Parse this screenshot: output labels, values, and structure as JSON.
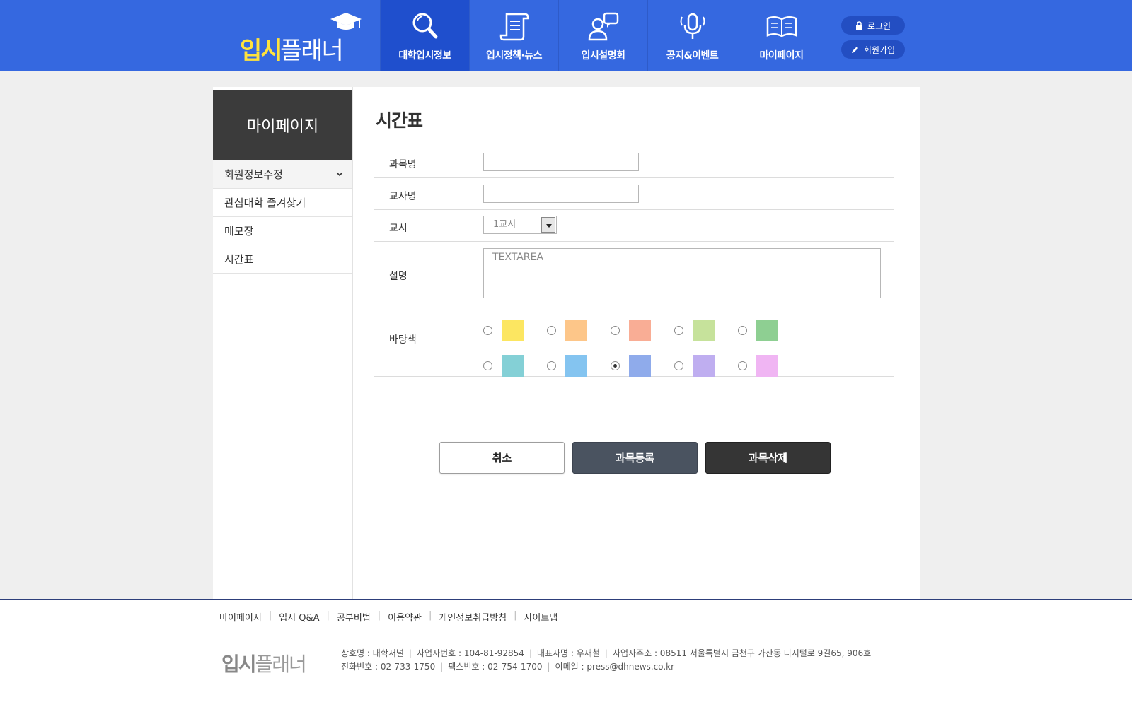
{
  "header": {
    "logo_bold": "입시",
    "logo_rest": "플래너",
    "nav": [
      {
        "label": "대학입시정보",
        "icon": "magnifier-icon"
      },
      {
        "label": "입시정책·뉴스",
        "icon": "scroll-icon"
      },
      {
        "label": "입시설명회",
        "icon": "people-chat-icon"
      },
      {
        "label": "공지&이벤트",
        "icon": "microphone-icon"
      },
      {
        "label": "마이페이지",
        "icon": "open-book-icon"
      }
    ],
    "login": "로그인",
    "join": "회원가입"
  },
  "sidebar": {
    "title": "마이페이지",
    "items": [
      "회원정보수정",
      "관심대학 즐겨찾기",
      "메모장",
      "시간표"
    ]
  },
  "main": {
    "title": "시간표",
    "fields": {
      "subject_label": "과목명",
      "teacher_label": "교사명",
      "period_label": "교시",
      "period_value": "1교시",
      "desc_label": "설명",
      "desc_placeholder": "TEXTAREA",
      "color_label": "바탕색"
    },
    "colors": [
      "#fce661",
      "#fdc689",
      "#f9ad95",
      "#c6e29b",
      "#8ecf92",
      "#84d0d6",
      "#84c4f0",
      "#8fabeb",
      "#bfaef0",
      "#f0b5f3"
    ],
    "selected_color_index": 7,
    "buttons": {
      "cancel": "취소",
      "register": "과목등록",
      "delete": "과목삭제"
    }
  },
  "footer": {
    "links": [
      "마이페이지",
      "입시 Q&A",
      "공부비법",
      "이용약관",
      "개인정보취급방침",
      "사이트맵"
    ],
    "logo_bold": "입시",
    "logo_rest": "플래너",
    "line1": [
      "상호명 : 대학저널",
      "사업자번호 : 104-81-92854",
      "대표자명 : 우재철",
      "사업자주소 : 08511 서울특별시 금천구 가산동 디지털로 9길65, 906호"
    ],
    "line2": [
      "전화번호 : 02-733-1750",
      "팩스번호 : 02-754-1700",
      "이메일 : press@dhnews.co.kr"
    ]
  }
}
